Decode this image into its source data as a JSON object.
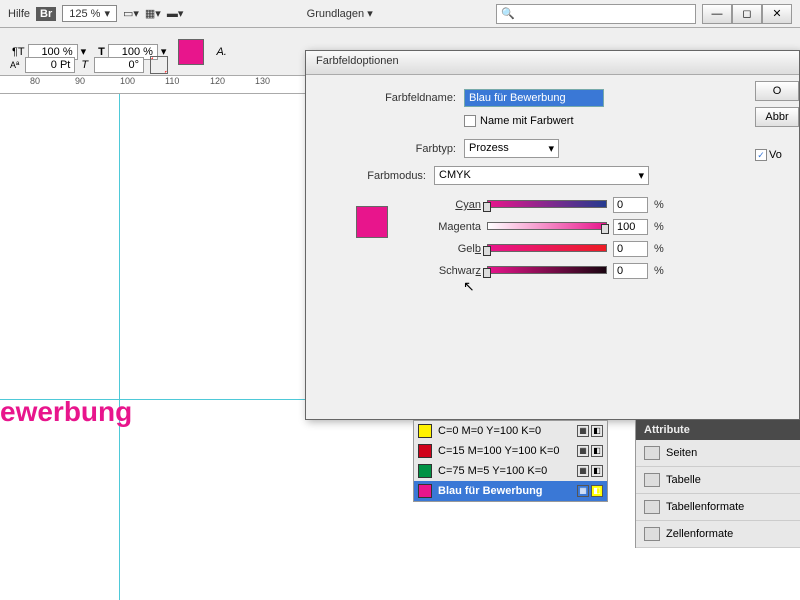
{
  "topbar": {
    "help": "Hilfe",
    "zoom": "125 %",
    "workspace": "Grundlagen"
  },
  "toolbar": {
    "scale1": "100 %",
    "scale2": "100 %",
    "pt": "0 Pt",
    "deg": "0°"
  },
  "ruler": [
    "80",
    "90",
    "100",
    "110",
    "120",
    "130"
  ],
  "canvasText": "ewerbung",
  "dialog": {
    "title": "Farbfeldoptionen",
    "labels": {
      "name": "Farbfeldname:",
      "nameColor": "Name mit Farbwert",
      "type": "Farbtyp:",
      "mode": "Farbmodus:"
    },
    "nameValue": "Blau für Bewerbung",
    "typeValue": "Prozess",
    "modeValue": "CMYK",
    "channels": [
      {
        "label": "Cyan",
        "val": "0"
      },
      {
        "label": "Magenta",
        "val": "100"
      },
      {
        "label": "Gelb",
        "val": "0"
      },
      {
        "label": "Schwarz",
        "val": "0"
      }
    ],
    "pct": "%",
    "buttons": {
      "ok": "O",
      "cancel": "Abbr",
      "preview": "Vo"
    }
  },
  "swatches": [
    {
      "color": "#fff200",
      "label": "C=0 M=0 Y=100 K=0"
    },
    {
      "color": "#d0021b",
      "label": "C=15 M=100 Y=100 K=0"
    },
    {
      "color": "#009245",
      "label": "C=75 M=5 Y=100 K=0"
    },
    {
      "color": "#e8158c",
      "label": "Blau für Bewerbung",
      "sel": true
    }
  ],
  "rpanel": {
    "head": "Attribute",
    "items": [
      "Seiten",
      "Tabelle",
      "Tabellenformate",
      "Zellenformate"
    ]
  }
}
